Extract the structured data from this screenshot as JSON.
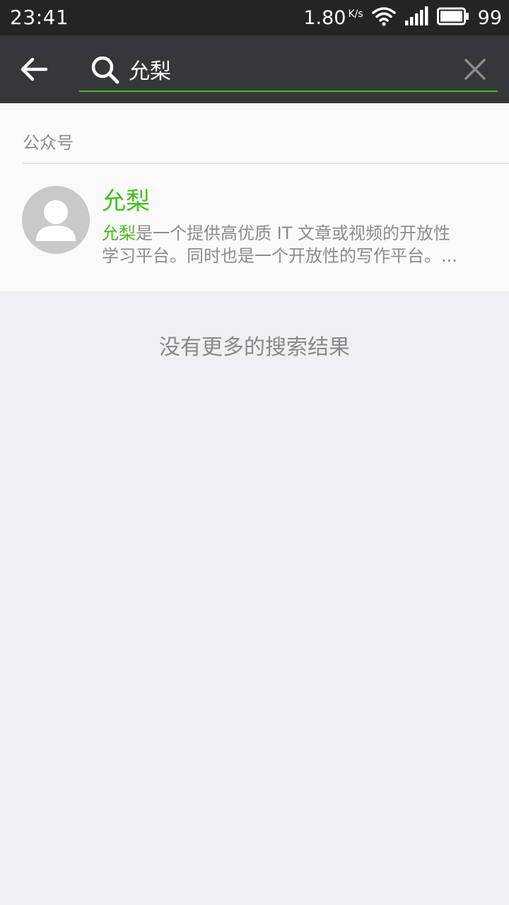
{
  "status_bar": {
    "time": "23:41",
    "speed": "1.80",
    "speed_unit": "K/s",
    "battery_level": "99",
    "icons": [
      "wifi-icon",
      "signal-icon",
      "battery-icon"
    ]
  },
  "toolbar": {
    "back_icon": "arrow-left-icon",
    "search_icon": "search-icon",
    "clear_icon": "close-icon"
  },
  "search": {
    "value": "允梨"
  },
  "results": {
    "section_title": "公众号",
    "items": [
      {
        "name": "允梨",
        "desc_highlight": "允梨",
        "desc_line1_rest": "是一个提供高优质 IT 文章或视频的开放性",
        "desc_line2": "学习平台。同时也是一个开放性的写作平台。..."
      }
    ]
  },
  "footer": {
    "no_more_text": "没有更多的搜索结果"
  },
  "colors": {
    "accent": "#45c01a",
    "status_bar_bg": "#242424",
    "toolbar_bg": "#36373a",
    "page_bg": "#efeff4",
    "card_bg": "#fafafa"
  }
}
